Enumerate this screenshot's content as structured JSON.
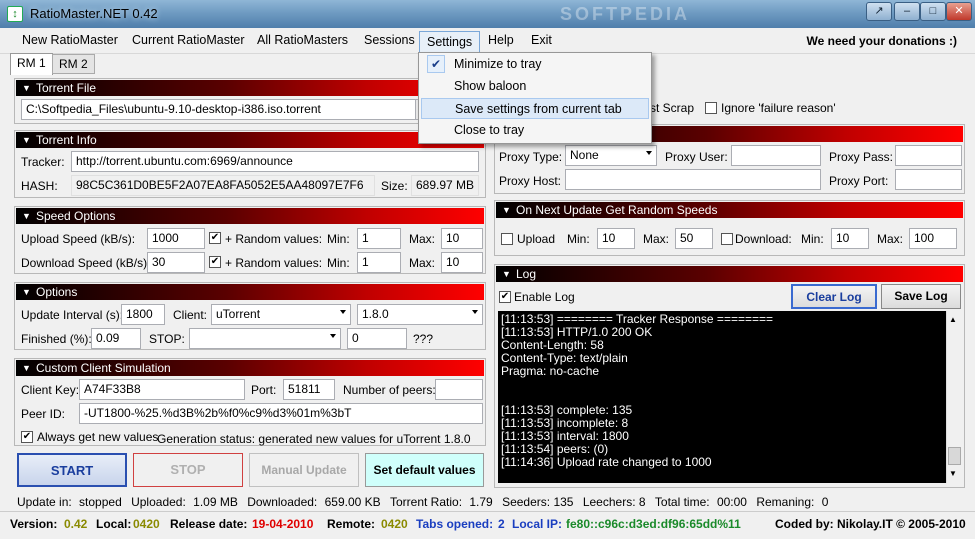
{
  "window": {
    "title": "RatioMaster.NET 0.42",
    "watermark": "SOFTPEDIA"
  },
  "menu": {
    "items": [
      "New RatioMaster",
      "Current RatioMaster",
      "All RatioMasters",
      "Sessions",
      "Settings",
      "Help",
      "Exit"
    ],
    "donation": "We need your donations :)"
  },
  "tabs": [
    "RM 1",
    "RM 2"
  ],
  "settings_menu": {
    "items": [
      "Minimize to tray",
      "Show baloon",
      "Save settings from current tab",
      "Close to tray"
    ],
    "checked_index": 0,
    "highlight_index": 2
  },
  "torrent_file": {
    "header": "Torrent File",
    "path": "C:\\Softpedia_Files\\ubuntu-9.10-desktop-i386.iso.torrent"
  },
  "torrent_info": {
    "header": "Torrent Info",
    "tracker_label": "Tracker:",
    "tracker": "http://torrent.ubuntu.com:6969/announce",
    "hash_label": "HASH:",
    "hash": "98C5C361D0BE5F2A07EA8FA5052E5AA48097E7F6",
    "size_label": "Size:",
    "size": "689.97 MB"
  },
  "speed": {
    "header": "Speed Options",
    "upload_label": "Upload Speed (kB/s):",
    "upload": "1000",
    "download_label": "Download Speed (kB/s):",
    "download": "30",
    "random_label": "+ Random values:",
    "min_label": "Min:",
    "max_label": "Max:",
    "up_min": "1",
    "up_max": "10",
    "down_min": "1",
    "down_max": "10"
  },
  "options": {
    "header": "Options",
    "interval_label": "Update Interval (s):",
    "interval": "1800",
    "client_label": "Client:",
    "client": "uTorrent",
    "version": "1.8.0",
    "finished_label": "Finished (%):",
    "finished": "0.09",
    "stop_label": "STOP:",
    "stop_value": "0",
    "qmarks": "???"
  },
  "custom_client": {
    "header": "Custom Client Simulation",
    "key_label": "Client Key:",
    "key": "A74F33B8",
    "port_label": "Port:",
    "port": "51811",
    "peers_label": "Number of peers:",
    "peerid_label": "Peer ID:",
    "peerid": "-UT1800-%25.%d3B%2b%f0%c9%d3%01m%3bT",
    "always_label": "Always get new values",
    "gen_status": "Generation status: generated new values for uTorrent 1.8.0"
  },
  "buttons": {
    "start": "START",
    "stop": "STOP",
    "manual": "Manual Update",
    "defaults": "Set default values"
  },
  "right_top": {
    "scrap_label": "st Scrap",
    "ignore_label": "Ignore 'failure reason'"
  },
  "proxy": {
    "type_label": "Proxy Type:",
    "type": "None",
    "user_label": "Proxy User:",
    "pass_label": "Proxy Pass:",
    "host_label": "Proxy Host:",
    "port_label": "Proxy Port:"
  },
  "random_speeds": {
    "header": "On Next Update Get Random Speeds",
    "upload_label": "Upload",
    "download_label": "Download:",
    "min_label": "Min:",
    "max_label": "Max:",
    "up_min": "10",
    "up_max": "50",
    "down_min": "10",
    "down_max": "100"
  },
  "log": {
    "header": "Log",
    "enable_label": "Enable Log",
    "clear_label": "Clear Log",
    "save_label": "Save Log",
    "lines": [
      "[11:13:53] ======== Tracker Response ========",
      "[11:13:53] HTTP/1.0 200 OK",
      "Content-Length: 58",
      "Content-Type: text/plain",
      "Pragma: no-cache",
      "",
      "",
      "[11:13:53] complete: 135",
      "[11:13:53] incomplete: 8",
      "[11:13:53] interval: 1800",
      "[11:13:54] peers: (0)",
      "[11:14:36] Upload rate changed to 1000"
    ]
  },
  "status": {
    "update_in_label": "Update in:",
    "update_in": "stopped",
    "uploaded_label": "Uploaded:",
    "uploaded": "1.09 MB",
    "downloaded_label": "Downloaded:",
    "downloaded": "659.00 KB",
    "ratio_label": "Torrent Ratio:",
    "ratio": "1.79",
    "seeders_label": "Seeders:",
    "seeders": "135",
    "leechers_label": "Leechers:",
    "leechers": "8",
    "total_label": "Total time:",
    "total": "00:00",
    "remaining_label": "Remaning:",
    "remaining": "0"
  },
  "footer": {
    "version_label": "Version:",
    "version": "0.42",
    "local_label": "Local:",
    "local": "0420",
    "release_label": "Release date:",
    "release": "19-04-2010",
    "remote_label": "Remote:",
    "remote": "0420",
    "tabs_label": "Tabs opened:",
    "tabs": "2",
    "ip_label": "Local IP:",
    "ip": "fe80::c96c:d3ed:df96:65dd%11",
    "coded": "Coded by: Nikolay.IT © 2005-2010"
  },
  "colors": {
    "header_red": "#c00000",
    "start_blue": "#1a3e9e",
    "stop_red": "#c00000",
    "value_olive": "#8a8a00",
    "date_red": "#e00000"
  }
}
